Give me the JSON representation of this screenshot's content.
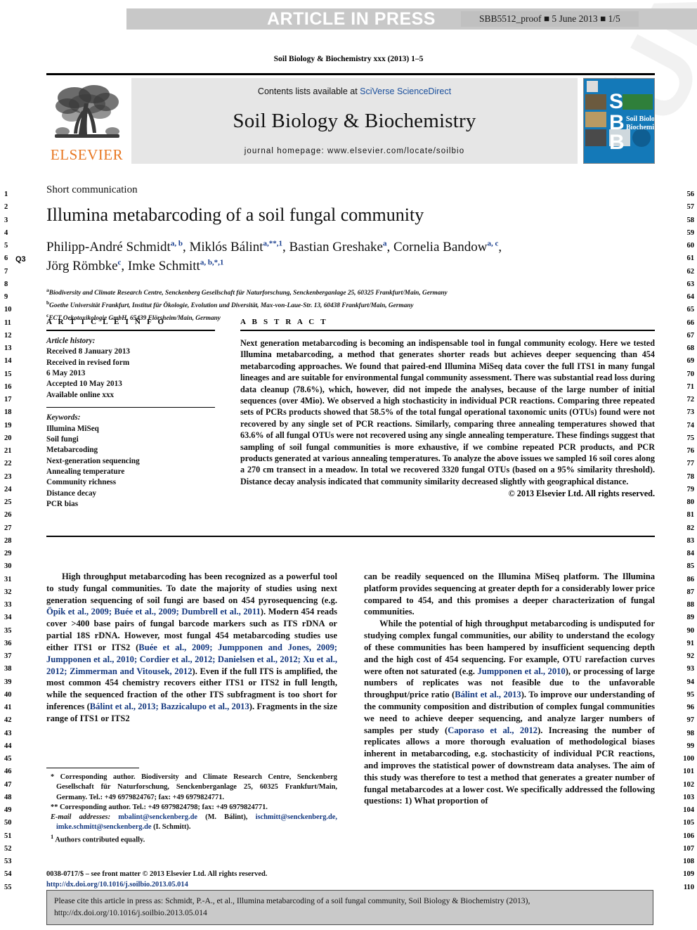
{
  "proof_banner": {
    "status": "ARTICLE IN PRESS",
    "proof_id": "SBB5512_proof ■ 5 June 2013 ■ 1/5"
  },
  "running_head": "Soil Biology & Biochemistry xxx (2013) 1–5",
  "masthead": {
    "contents_prefix": "Contents lists available at ",
    "contents_link": "SciVerse ScienceDirect",
    "journal_name": "Soil Biology & Biochemistry",
    "homepage": "journal homepage: www.elsevier.com/locate/soilbio",
    "publisher_name": "ELSEVIER",
    "cover_title_line1": "Soil Biology &",
    "cover_title_line2": "Biochemistry",
    "cover_letters": [
      "S",
      "B",
      "B"
    ]
  },
  "article": {
    "section_type": "Short communication",
    "title": "Illumina metabarcoding of a soil fungal community",
    "query_marker": "Q3",
    "authors_line1_parts": [
      {
        "name": "Philipp-André Schmidt",
        "sup": "a, b"
      },
      {
        "name": ", Miklós Bálint",
        "sup": "a,**,1"
      },
      {
        "name": ", Bastian Greshake",
        "sup": "a"
      },
      {
        "name": ", Cornelia Bandow",
        "sup": "a, c"
      }
    ],
    "authors_line1_tail": ",",
    "authors_line2_parts": [
      {
        "name": "Jörg Römbke",
        "sup": "c"
      },
      {
        "name": ", Imke Schmitt",
        "sup": "a, b,*,1"
      }
    ],
    "affiliations": [
      {
        "sup": "a",
        "text": "Biodiversity and Climate Research Centre, Senckenberg Gesellschaft für Naturforschung, Senckenberganlage 25, 60325 Frankfurt/Main, Germany"
      },
      {
        "sup": "b",
        "text": "Goethe Universität Frankfurt, Institut für Ökologie, Evolution und Diversität, Max-von-Laue-Str. 13, 60438 Frankfurt/Main, Germany"
      },
      {
        "sup": "c",
        "text": "ECT Oekotoxikologie GmbH, 65439 Flörsheim/Main, Germany"
      }
    ]
  },
  "info_panel": {
    "heading": "A R T I C L E   I N F O",
    "history_label": "Article history:",
    "history": [
      "Received 8 January 2013",
      "Received in revised form",
      "6 May 2013",
      "Accepted 10 May 2013",
      "Available online xxx"
    ],
    "keywords_label": "Keywords:",
    "keywords": [
      "Illumina MiSeq",
      "Soil fungi",
      "Metabarcoding",
      "Next-generation sequencing",
      "Annealing temperature",
      "Community richness",
      "Distance decay",
      "PCR bias"
    ]
  },
  "abstract_panel": {
    "heading": "A B S T R A C T",
    "body": "Next generation metabarcoding is becoming an indispensable tool in fungal community ecology. Here we tested Illumina metabarcoding, a method that generates shorter reads but achieves deeper sequencing than 454 metabarcoding approaches. We found that paired-end Illumina MiSeq data cover the full ITS1 in many fungal lineages and are suitable for environmental fungal community assessment. There was substantial read loss during data cleanup (78.6%), which, however, did not impede the analyses, because of the large number of initial sequences (over 4Mio). We observed a high stochasticity in individual PCR reactions. Comparing three repeated sets of PCRs products showed that 58.5% of the total fungal operational taxonomic units (OTUs) found were not recovered by any single set of PCR reactions. Similarly, comparing three annealing temperatures showed that 63.6% of all fungal OTUs were not recovered using any single annealing temperature. These findings suggest that sampling of soil fungal communities is more exhaustive, if we combine repeated PCR products, and PCR products generated at various annealing temperatures. To analyze the above issues we sampled 16 soil cores along a 270 cm transect in a meadow. In total we recovered 3320 fungal OTUs (based on a 95% similarity threshold). Distance decay analysis indicated that community similarity decreased slightly with geographical distance.",
    "copyright": "© 2013 Elsevier Ltd. All rights reserved."
  },
  "body": {
    "left_para1_a": "High throughput metabarcoding has been recognized as a powerful tool to study fungal communities. To date the majority of studies using next generation sequencing of soil fungi are based on 454 pyrosequencing (e.g. ",
    "left_para1_refs1": "Öpik et al., 2009; Buée et al., 2009; Dumbrell et al., 2011",
    "left_para1_b": "). Modern 454 reads cover >400 base pairs of fungal barcode markers such as ITS rDNA or partial 18S rDNA. However, most fungal 454 metabarcoding studies use either ITS1 or ITS2 (",
    "left_para1_refs2": "Buée et al., 2009; Jumpponen and Jones, 2009; Jumpponen et al., 2010; Cordier et al., 2012; Danielsen et al., 2012; Xu et al., 2012; Zimmerman and Vitousek, 2012",
    "left_para1_c": "). Even if the full ITS is amplified, the most common 454 chemistry recovers either ITS1 or ITS2 in full length, while the sequenced fraction of the other ITS subfragment is too short for inferences (",
    "left_para1_refs3": "Bálint et al., 2013; Bazzicalupo et al., 2013",
    "left_para1_d": "). Fragments in the size range of ITS1 or ITS2",
    "right_para1": "can be readily sequenced on the Illumina MiSeq platform. The Illumina platform provides sequencing at greater depth for a considerably lower price compared to 454, and this promises a deeper characterization of fungal communities.",
    "right_para2_a": "While the potential of high throughput metabarcoding is undisputed for studying complex fungal communities, our ability to understand the ecology of these communities has been hampered by insufficient sequencing depth and the high cost of 454 sequencing. For example, OTU rarefaction curves were often not saturated (e.g. ",
    "right_para2_ref1": "Jumpponen et al., 2010",
    "right_para2_b": "), or processing of large numbers of replicates was not feasible due to the unfavorable throughput/price ratio (",
    "right_para2_ref2": "Bálint et al., 2013",
    "right_para2_c": "). To improve our understanding of the community composition and distribution of complex fungal communities we need to achieve deeper sequencing, and analyze larger numbers of samples per study (",
    "right_para2_ref3": "Caporaso et al., 2012",
    "right_para2_d": "). Increasing the number of replicates allows a more thorough evaluation of methodological biases inherent in metabarcoding, e.g. stochasticity of individual PCR reactions, and improves the statistical power of downstream data analyses. The aim of this study was therefore to test a method that generates a greater number of fungal metabarcodes at a lower cost. We specifically addressed the following questions: 1) What proportion of"
  },
  "footnotes": {
    "fn1": "* Corresponding author. Biodiversity and Climate Research Centre, Senckenberg Gesellschaft für Naturforschung, Senckenberganlage 25, 60325 Frankfurt/Main, Germany. Tel.: +49 6979824767; fax: +49 6979824771.",
    "fn2": "** Corresponding author. Tel.: +49 6979824798; fax: +49 6979824771.",
    "fn3_label": "E-mail addresses:",
    "fn3_email1": "mbalint@senckenberg.de",
    "fn3_mid1": " (M. Bálint), ",
    "fn3_email2": "ischmitt@senckenberg.de, imke.schmitt@senckenberg.de",
    "fn3_mid2": " (I. Schmitt).",
    "fn4_sup": "1",
    "fn4": "Authors contributed equally."
  },
  "issn": {
    "line1": "0038-0717/$ – see front matter © 2013 Elsevier Ltd. All rights reserved.",
    "doi": "http://dx.doi.org/10.1016/j.soilbio.2013.05.014"
  },
  "cite_box": {
    "line1": "Please cite this article in press as: Schmidt, P.-A., et al., Illumina metabarcoding of a soil fungal community, Soil Biology & Biochemistry (2013),",
    "line2": "http://dx.doi.org/10.1016/j.soilbio.2013.05.014"
  },
  "line_numbers": {
    "left_start": 1,
    "left_end": 55,
    "right_start": 56,
    "right_end": 110
  },
  "watermark": "UNCORRECTED PROOF",
  "colors": {
    "banner_bg": "#c8c8c8",
    "link_blue": "#14387f",
    "elsevier_orange": "#E87722",
    "cover_blue": "#1479b8",
    "panel_grey": "#e6e6e6"
  }
}
